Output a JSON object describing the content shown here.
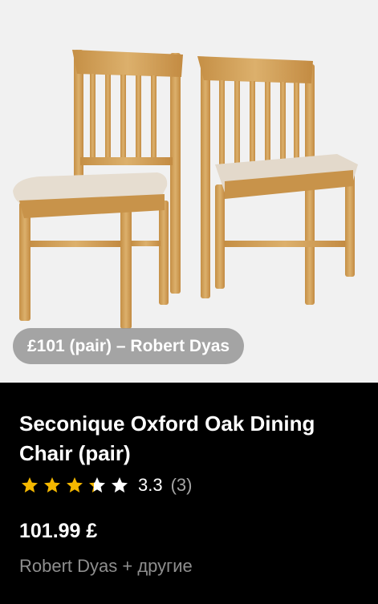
{
  "product": {
    "image_alt": "Two oak dining chairs with beige upholstered seats",
    "price_tag": "£101 (pair) – Robert Dyas",
    "title": "Seconique Oxford Oak Dining Chair (pair)",
    "rating": {
      "value": "3.3",
      "count": "(3)",
      "stars_filled": 3.3,
      "stars_total": 5
    },
    "price": "101.99 £",
    "seller": "Robert Dyas + другие"
  },
  "colors": {
    "star": "#f5b800",
    "star_empty": "#ffffff",
    "wood": "#d4a35a",
    "cushion": "#e6ddd0"
  }
}
